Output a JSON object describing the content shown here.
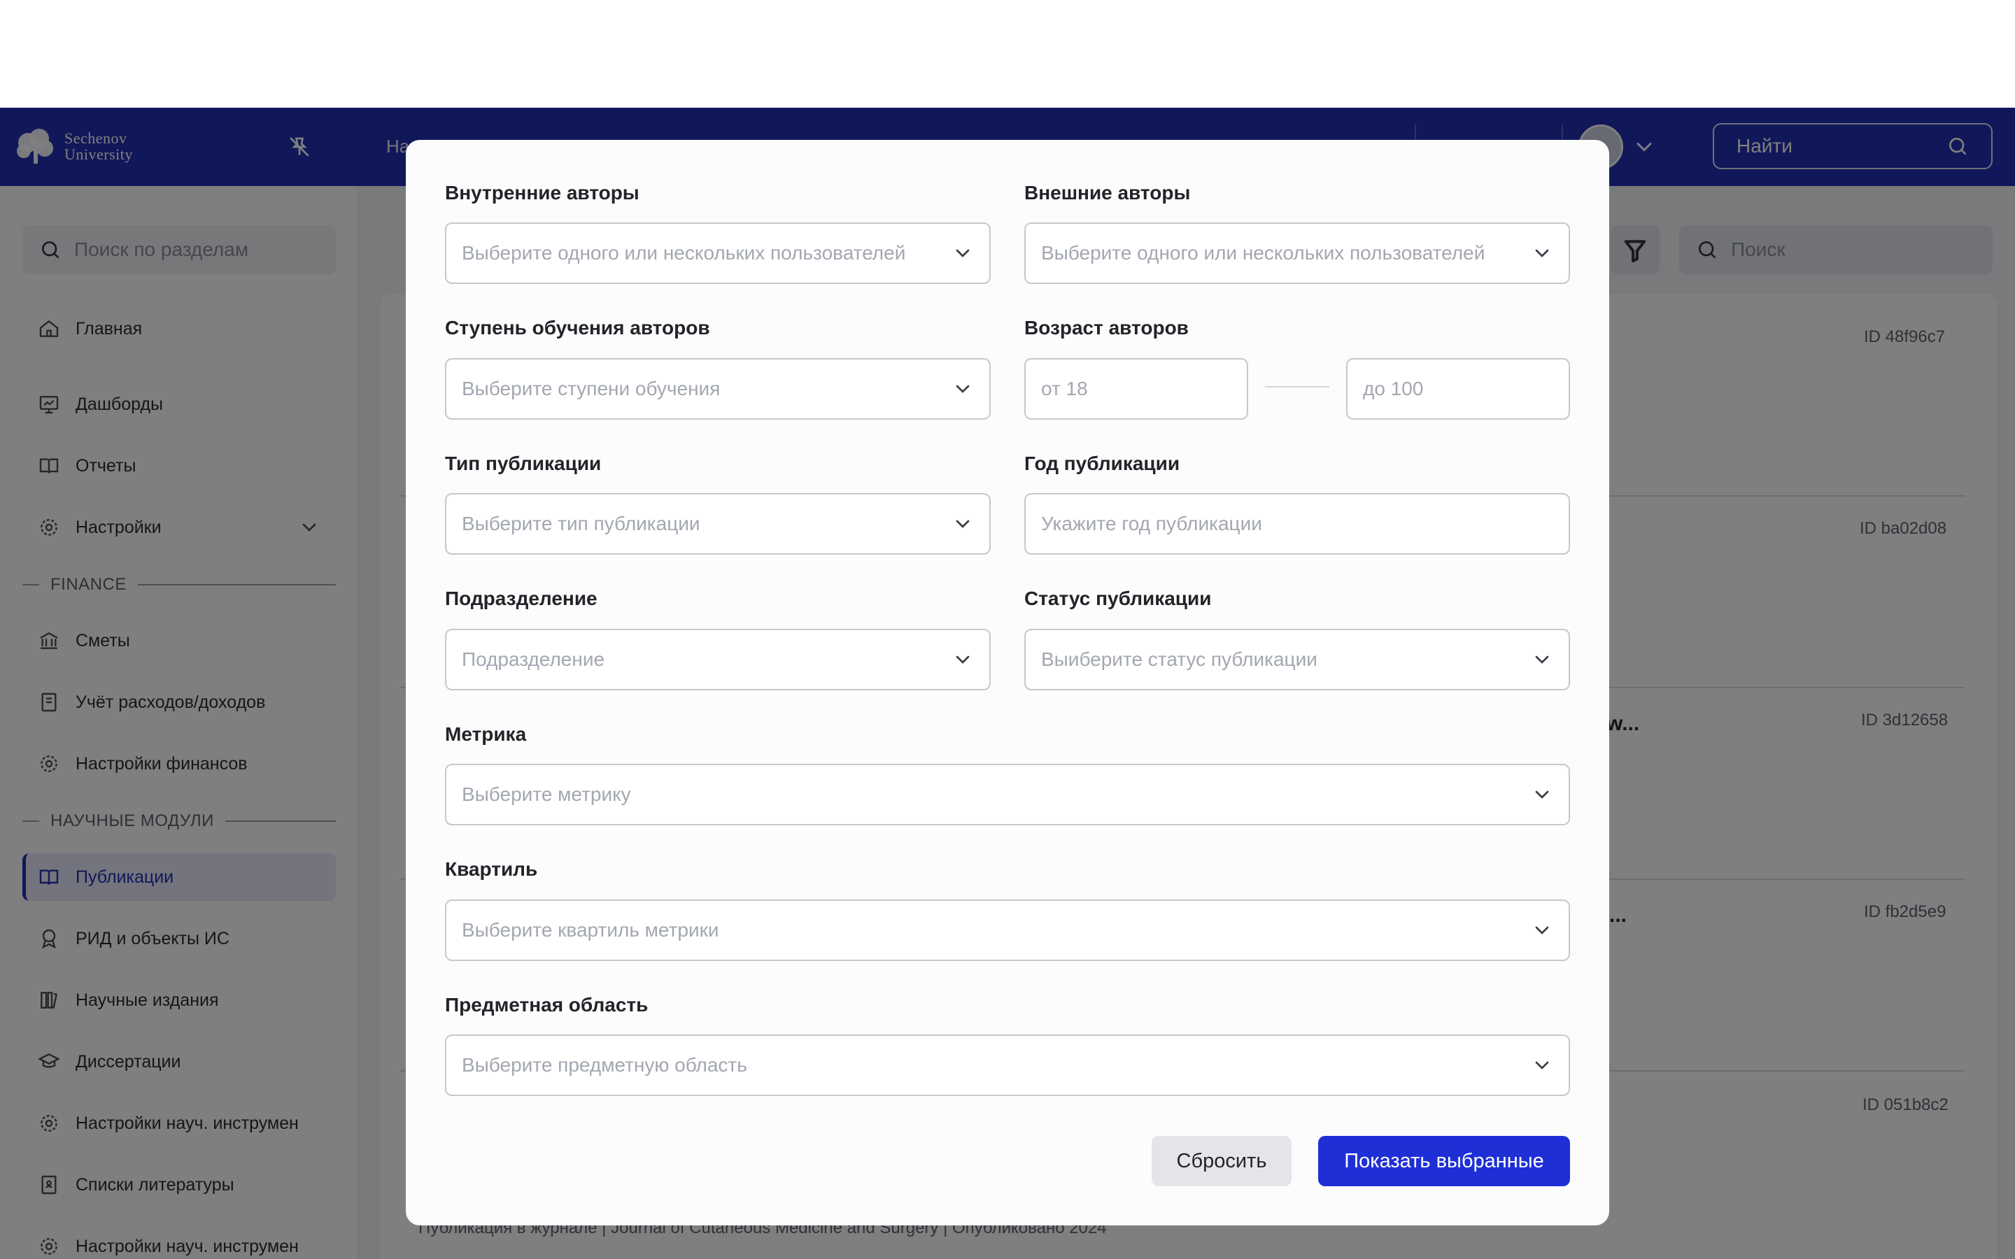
{
  "app": {
    "logo_line1": "Sechenov",
    "logo_line2": "University",
    "nav_text": "На",
    "top_search_label": "Найти"
  },
  "sidebar": {
    "search_placeholder": "Поиск по разделам",
    "items": [
      {
        "label": "Главная",
        "icon": "home-icon"
      },
      {
        "label": "Дашборды",
        "icon": "dashboard-icon"
      },
      {
        "label": "Отчеты",
        "icon": "book-icon"
      },
      {
        "label": "Настройки",
        "icon": "gear-icon"
      },
      {
        "label": "Сметы",
        "icon": "bank-icon"
      },
      {
        "label": "Учёт расходов/доходов",
        "icon": "ledger-icon"
      },
      {
        "label": "Настройки финансов",
        "icon": "gear-icon"
      },
      {
        "label": "Публикации",
        "icon": "book-icon"
      },
      {
        "label": "РИД и объекты ИС",
        "icon": "award-icon"
      },
      {
        "label": "Научные издания",
        "icon": "books-icon"
      },
      {
        "label": "Диссертации",
        "icon": "graduation-cap-icon"
      },
      {
        "label": "Настройки науч. инструмен",
        "icon": "gear-icon"
      },
      {
        "label": "Списки литературы",
        "icon": "contacts-book-icon"
      },
      {
        "label": "Настройки науч. инструмен",
        "icon": "gear-icon"
      }
    ],
    "sections": [
      "FINANCE",
      "НАУЧНЫЕ МОДУЛИ"
    ]
  },
  "content": {
    "search_placeholder": "Поиск",
    "rows": [
      {
        "id": "ID 48f96c7",
        "title": ""
      },
      {
        "id": "ID ba02d08",
        "title": ""
      },
      {
        "id": "ID 3d12658",
        "title": "w..."
      },
      {
        "id": "ID fb2d5e9",
        "title": "..."
      },
      {
        "id": "ID 051b8c2",
        "title": ""
      }
    ],
    "last_meta": "Публикация в журнале | Journal of Cutaneous Medicine and Surgery | Опубликовано 2024"
  },
  "modal": {
    "internal_authors": {
      "label": "Внутренние авторы",
      "placeholder": "Выберите одного или нескольких пользователей"
    },
    "external_authors": {
      "label": "Внешние авторы",
      "placeholder": "Выберите одного или нескольких пользователей"
    },
    "education_level": {
      "label": "Ступень обучения авторов",
      "placeholder": "Выберите ступени обучения"
    },
    "age": {
      "label": "Возраст авторов",
      "from_placeholder": "от 18",
      "to_placeholder": "до 100"
    },
    "publication_type": {
      "label": "Тип публикации",
      "placeholder": "Выберите тип публикации"
    },
    "publication_year": {
      "label": "Год публикации",
      "placeholder": "Укажите год публикации"
    },
    "department": {
      "label": "Подразделение",
      "placeholder": "Подразделение"
    },
    "publication_status": {
      "label": "Статус публикации",
      "placeholder": "Выиберите статус публикации"
    },
    "metric": {
      "label": "Метрика",
      "placeholder": "Выберите метрику"
    },
    "quartile": {
      "label": "Квартиль",
      "placeholder": "Выберите квартиль метрики"
    },
    "subject_area": {
      "label": "Предметная область",
      "placeholder": "Выберите предметную область"
    },
    "reset_label": "Сбросить",
    "apply_label": "Показать выбранные"
  },
  "colors": {
    "brand": "#2230b3",
    "primary_button": "#1f2fd6"
  }
}
